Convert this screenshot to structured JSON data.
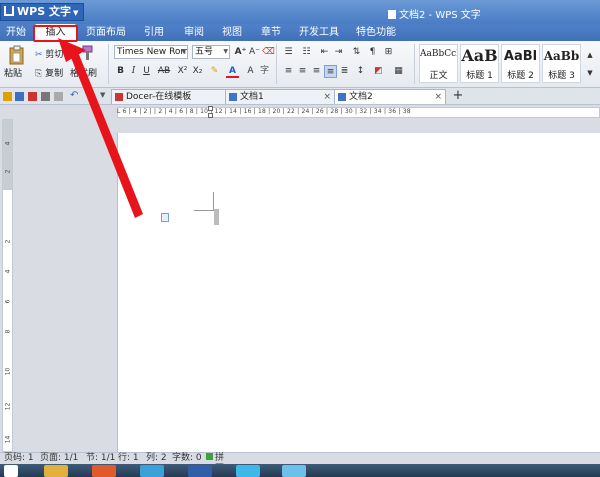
{
  "app": {
    "name": "WPS 文字",
    "window_title": "文档2 - WPS 文字"
  },
  "menu_tabs": [
    "开始",
    "插入",
    "页面布局",
    "引用",
    "审阅",
    "视图",
    "章节",
    "开发工具",
    "特色功能"
  ],
  "active_menu": "插入",
  "clipboard": {
    "paste": "粘贴",
    "cut": "剪切",
    "copy": "复制",
    "format_painter": "格式刷"
  },
  "font": {
    "family": "Times New Roman",
    "size": "五号"
  },
  "styles": [
    {
      "sample": "AaBbCcDc",
      "name": "正文"
    },
    {
      "sample": "AaB",
      "name": "标题 1"
    },
    {
      "sample": "AaBl",
      "name": "标题 2"
    },
    {
      "sample": "AaBb",
      "name": "标题 3"
    }
  ],
  "doc_tabs": [
    "Docer-在线模板",
    "文档1",
    "文档2"
  ],
  "active_doc_tab": "文档2",
  "ruler": {
    "h_numbers": "L  6 | 4 | 2 |   | 2 | 4 | 6 | 8 | 10 | 12 | 14 | 16 | 18 | 20 | 22 | 24 | 26 | 28 | 30 | 32 | 34 | 36 | 38",
    "v_numbers": [
      "4",
      "2",
      "2",
      "4",
      "6",
      "8",
      "10",
      "12",
      "14"
    ]
  },
  "status": {
    "page": "页码: 1",
    "pages": "页面: 1/1",
    "section": "节: 1/1",
    "row": "行: 1",
    "col": "列: 2",
    "words": "字数: 0",
    "spell": "拼写检查"
  },
  "colors": {
    "title_bar": "#4a7cc4",
    "annotation": "#e8141b",
    "ribbon": "#eef1f5"
  }
}
